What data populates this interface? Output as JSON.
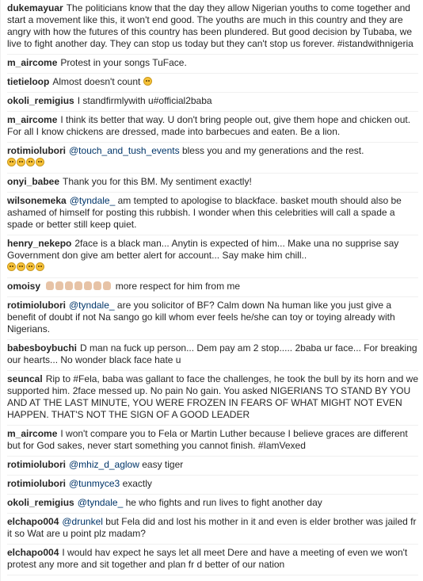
{
  "comments": [
    {
      "user": "dukemayuar",
      "text": "The politicians know that the day they allow Nigerian youths to come together and start a movement like this, it won't end good. The youths are much in this country and they are angry with how the futures of this country has been plundered. But good decision by Tubaba, we live to fight another day. They can stop us today but they can't stop us forever. #istandwithnigeria"
    },
    {
      "user": "m_aircome",
      "text": "Protest in your songs TuFace."
    },
    {
      "user": "tietieloop",
      "text": "Almost doesn't count"
    },
    {
      "user": "okoli_remigius",
      "text": "I standfirmlywith u#official2baba"
    },
    {
      "user": "m_aircome",
      "text": "I think its better that way. U don't bring people out, give them hope and chicken out. For all I know chickens are dressed, made into barbecues and eaten. Be a lion."
    },
    {
      "user": "rotimiolubori",
      "mention": "@touch_and_tush_events",
      "text": "bless you and my generations and the rest."
    },
    {
      "user": "onyi_babee",
      "text": "Thank you for this BM. My sentiment exactly!"
    },
    {
      "user": "wilsonemeka",
      "mention": "@tyndale_",
      "text": "am tempted to apologise to blackface. basket mouth should also be ashamed of himself for posting this rubbish. I wonder when this celebrities will call a spade a spade or better still keep quiet."
    },
    {
      "user": "henry_nekepo",
      "text": "2face is a black man... Anytin is expected of him... Make una no supprise say Government don give am better alert for account... Say make him chill.."
    },
    {
      "user": "omoisy",
      "text": "more respect for him from me"
    },
    {
      "user": "rotimiolubori",
      "mention": "@tyndale_",
      "text": "are you solicitor of BF? Calm down Na human like you just give a benefit of doubt if not Na sango go kill whom ever feels he/she can toy or toying already with Nigerians."
    },
    {
      "user": "babesboybuchi",
      "text": "D man na fuck up person... Dem pay am 2 stop..... 2baba ur face... For breaking our hearts... No wonder black face hate u"
    },
    {
      "user": "seuncal",
      "text": "Rip to #Fela, baba was gallant to face the challenges, he took the bull by its horn and we supported him. 2face messed up. No pain No gain. You asked NIGERIANS TO STAND BY YOU AND AT THE LAST MINUTE, YOU WERE FROZEN IN FEARS OF WHAT MIGHT NOT EVEN HAPPEN. THAT'S NOT THE SIGN OF A GOOD LEADER"
    },
    {
      "user": "m_aircome",
      "text": "I won't compare you to Fela or Martin Luther because I believe graces are different but for God sakes, never start something you cannot finish. #IamVexed"
    },
    {
      "user": "rotimiolubori",
      "mention": "@mhiz_d_aglow",
      "text": "easy tiger"
    },
    {
      "user": "rotimiolubori",
      "mention": "@tunmyce3",
      "text": "exactly"
    },
    {
      "user": "okoli_remigius",
      "mention": "@tyndale_",
      "text": "he who fights and run lives to fight another day"
    },
    {
      "user": "elchapo004",
      "mention": "@drunkel",
      "text": "but Fela did and lost his mother in it and even is elder brother was jailed fr it so Wat are u point plz madam?"
    },
    {
      "user": "elchapo004",
      "text": "I would hav expect he says let all meet Dere and have a meeting of even we won't protest any more and sit together and plan fr d better of our nation"
    }
  ]
}
